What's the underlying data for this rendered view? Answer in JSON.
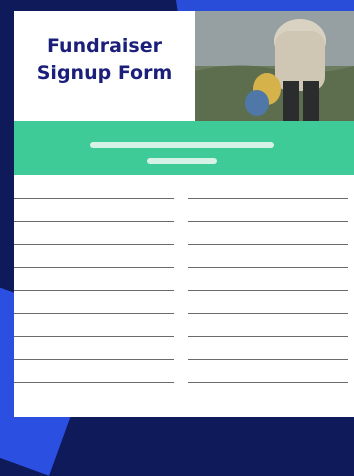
{
  "form": {
    "title_line1": "Fundraiser",
    "title_line2": "Signup Form"
  },
  "colors": {
    "background": "#0f1a5a",
    "accent_blue": "#2b4fe0",
    "title_text": "#1b1f7a",
    "banner": "#3ecb98"
  },
  "photo": {
    "description_icon": "person-walking-photo"
  },
  "signup_columns": [
    {
      "name": "left",
      "line_count": 9
    },
    {
      "name": "right",
      "line_count": 9
    }
  ]
}
